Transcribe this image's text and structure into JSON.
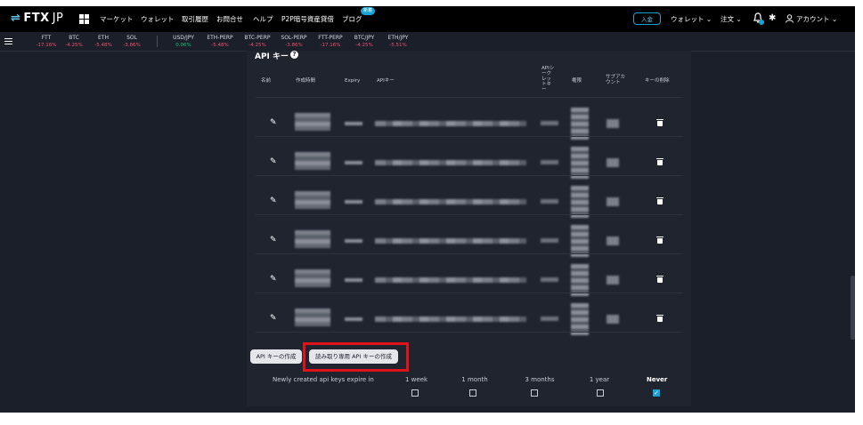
{
  "brand": {
    "name": "FTX",
    "suffix": "JP"
  },
  "nav": {
    "items": [
      "マーケット",
      "ウォレット",
      "取引履歴",
      "お問合せ",
      "ヘルプ",
      "P2P暗号資産貸借",
      "ブログ"
    ],
    "blog_badge": "新着"
  },
  "right_nav": {
    "deposit": "入金",
    "wallet": "ウォレット ⌄",
    "orders": "注文 ⌄",
    "account": "アカウント ⌄"
  },
  "tickers": [
    {
      "name": "FTT",
      "change": "-17.16%",
      "dir": "down"
    },
    {
      "name": "BTC",
      "change": "-4.25%",
      "dir": "down"
    },
    {
      "name": "ETH",
      "change": "-5.48%",
      "dir": "down"
    },
    {
      "name": "SOL",
      "change": "-3.86%",
      "dir": "down"
    },
    {
      "name": "USD/JPY",
      "change": "0.06%",
      "dir": "up"
    },
    {
      "name": "ETH-PERP",
      "change": "-5.48%",
      "dir": "down"
    },
    {
      "name": "BTC-PERP",
      "change": "-4.25%",
      "dir": "down"
    },
    {
      "name": "SOL-PERP",
      "change": "-3.86%",
      "dir": "down"
    },
    {
      "name": "FTT-PERP",
      "change": "-17.16%",
      "dir": "down"
    },
    {
      "name": "BTC/JPY",
      "change": "-4.25%",
      "dir": "down"
    },
    {
      "name": "ETH/JPY",
      "change": "-5.51%",
      "dir": "down"
    }
  ],
  "colors": {
    "up": "#19c37d",
    "down": "#f0506e",
    "accent": "#19a3d4",
    "highlight": "#e0131b"
  },
  "api_section": {
    "title": "API キー",
    "headers": {
      "name": "名前",
      "created": "作成時間",
      "expiry": "Expiry",
      "api_key": "APIキー",
      "secret": "APIシ\nーク\nレッ\nトキ\nー",
      "permission": "権限",
      "subaccount": "サブアカ\nウント",
      "delete": "キーの削除"
    },
    "rows": 6
  },
  "buttons": {
    "create": "API キーの作成",
    "create_readonly": "読み取り専用 API キーの作成"
  },
  "expiry": {
    "label": "Newly created api keys expire in",
    "options": [
      {
        "label": "1 week",
        "checked": false
      },
      {
        "label": "1 month",
        "checked": false
      },
      {
        "label": "3 months",
        "checked": false
      },
      {
        "label": "1 year",
        "checked": false
      },
      {
        "label": "Never",
        "checked": true
      }
    ]
  }
}
